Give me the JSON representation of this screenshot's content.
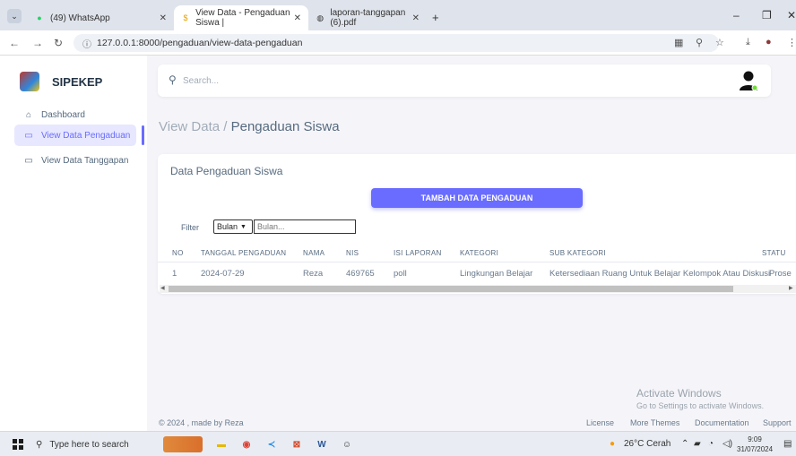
{
  "browser": {
    "tabs": [
      {
        "title": "(49) WhatsApp",
        "icon": "whatsapp-icon",
        "color": "#25d366"
      },
      {
        "title": "View Data - Pengaduan Siswa |",
        "icon": "app-favicon",
        "color": "#e6a100"
      },
      {
        "title": "laporan-tanggapan (6).pdf",
        "icon": "globe-icon",
        "color": "#555555"
      }
    ],
    "url": "127.0.0.1:8000/pengaduan/view-data-pengaduan"
  },
  "sidebar": {
    "brand": "SIPEKEP",
    "items": [
      {
        "label": "Dashboard",
        "icon": "home-icon",
        "active": false
      },
      {
        "label": "View Data Pengaduan",
        "icon": "tray-icon",
        "active": true
      },
      {
        "label": "View Data Tanggapan",
        "icon": "tray-icon",
        "active": false
      }
    ]
  },
  "topnav": {
    "search_placeholder": "Search..."
  },
  "page": {
    "breadcrumb_parent": "View Data /",
    "breadcrumb_current": "Pengaduan Siswa"
  },
  "card": {
    "title": "Data Pengaduan Siswa",
    "add_button": "TAMBAH DATA PENGADUAN",
    "filter_label": "Filter",
    "filter_select_value": "Bulan",
    "filter_input_placeholder": "Bulan...",
    "columns": [
      "NO",
      "TANGGAL PENGADUAN",
      "NAMA",
      "NIS",
      "ISI LAPORAN",
      "KATEGORI",
      "SUB KATEGORI",
      "STATU"
    ],
    "rows": [
      [
        "1",
        "2024-07-29",
        "Reza",
        "469765",
        "poll",
        "Lingkungan Belajar",
        "Ketersediaan Ruang Untuk Belajar Kelompok Atau Diskusi",
        "Prose"
      ]
    ]
  },
  "footer": {
    "copyright": "© 2024 , made by Reza",
    "links": [
      "License",
      "More Themes",
      "Documentation",
      "Support"
    ]
  },
  "watermark": {
    "line1": "Activate Windows",
    "line2": "Go to Settings to activate Windows."
  },
  "taskbar": {
    "search_placeholder": "Type here to search",
    "weather": "26°C Cerah",
    "time": "9:09",
    "date": "31/07/2024"
  },
  "colors": {
    "primary": "#696cff",
    "background": "#f5f5f9"
  }
}
